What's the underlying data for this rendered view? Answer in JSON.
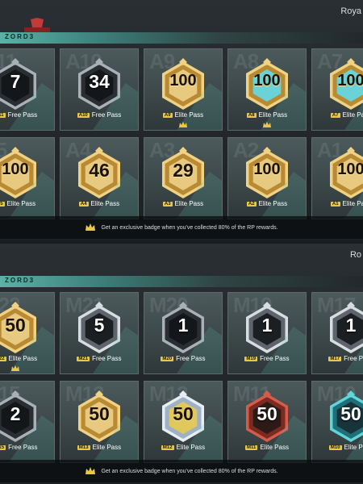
{
  "colors": {
    "accent": "#5ab2a6",
    "gold": "#d9b45a",
    "chip": "#e8c84a"
  },
  "panel1": {
    "header_right": "Roya",
    "strip_label": "ZORD3",
    "footer_text": "Get an exclusive badge when you've collected 80% of the RP rewards.",
    "cards": [
      {
        "code": "A11",
        "value": "7",
        "style": "dark",
        "pass": "Free Pass",
        "crown": false
      },
      {
        "code": "A10",
        "value": "34",
        "style": "dark",
        "pass": "Free Pass",
        "crown": false
      },
      {
        "code": "A9",
        "value": "100",
        "style": "gold",
        "pass": "Elite Pass",
        "crown": true
      },
      {
        "code": "A8",
        "value": "100",
        "style": "teal",
        "pass": "Elite Pass",
        "crown": true
      },
      {
        "code": "A7",
        "value": "100",
        "style": "teal",
        "pass": "Elite Pass",
        "crown": false
      },
      {
        "code": "A5",
        "value": "100",
        "style": "gold",
        "pass": "Elite Pass",
        "crown": false
      },
      {
        "code": "A4",
        "value": "46",
        "style": "gold",
        "pass": "Elite Pass",
        "crown": false
      },
      {
        "code": "A3",
        "value": "29",
        "style": "gold",
        "pass": "Elite Pass",
        "crown": false
      },
      {
        "code": "A2",
        "value": "100",
        "style": "gold",
        "pass": "Elite Pass",
        "crown": false
      },
      {
        "code": "A1",
        "value": "100",
        "style": "gold",
        "pass": "Elite Pass",
        "crown": false
      }
    ]
  },
  "panel2": {
    "header_right": "Ro",
    "strip_label": "ZORD3",
    "footer_text": "Get an exclusive badge when you've collected 80% of the RP rewards.",
    "cards": [
      {
        "code": "M22",
        "value": "50",
        "style": "gold",
        "pass": "Elite Pass",
        "crown": true
      },
      {
        "code": "M21",
        "value": "5",
        "style": "silver",
        "pass": "Free Pass",
        "crown": false
      },
      {
        "code": "M20",
        "value": "1",
        "style": "dark",
        "pass": "Free Pass",
        "crown": false
      },
      {
        "code": "M19",
        "value": "1",
        "style": "silver",
        "pass": "Free Pass",
        "crown": false
      },
      {
        "code": "M17",
        "value": "1",
        "style": "silver",
        "pass": "Free Pass",
        "crown": false
      },
      {
        "code": "M15",
        "value": "2",
        "style": "dark",
        "pass": "Free Pass",
        "crown": false
      },
      {
        "code": "M13",
        "value": "50",
        "style": "gold",
        "pass": "Elite Pass",
        "crown": false
      },
      {
        "code": "M12",
        "value": "50",
        "style": "blue",
        "pass": "Elite Pass",
        "crown": false
      },
      {
        "code": "M11",
        "value": "50",
        "style": "red",
        "pass": "Elite Pass",
        "crown": false
      },
      {
        "code": "M10",
        "value": "50",
        "style": "cyan",
        "pass": "Elite Pass",
        "crown": false
      }
    ]
  }
}
